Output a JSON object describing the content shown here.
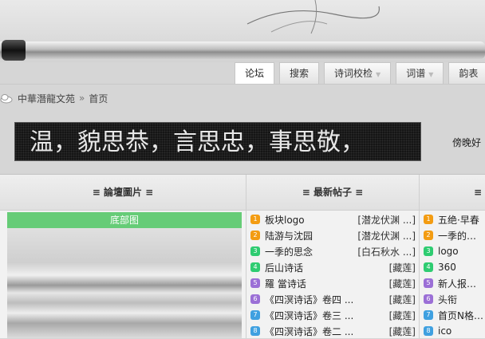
{
  "nav": {
    "tabs": [
      {
        "label": "论坛",
        "active": true,
        "arrow": false
      },
      {
        "label": "搜索",
        "active": false,
        "arrow": false
      },
      {
        "label": "诗词校检",
        "active": false,
        "arrow": true
      },
      {
        "label": "词谱",
        "active": false,
        "arrow": true
      },
      {
        "label": "韵表",
        "active": false,
        "arrow": false
      }
    ]
  },
  "breadcrumb": {
    "site": "中華潛龍文苑",
    "separator": "»",
    "page": "首页"
  },
  "banner": {
    "text": "温，貌思恭，言思忠，事思敬，"
  },
  "user": {
    "greeting": "傍晚好"
  },
  "panels": {
    "pictures": {
      "title": "≡ 論壇圖片 ≡",
      "caption": "底部图"
    },
    "latest": {
      "title": "≡ 最新帖子 ≡",
      "items": [
        {
          "n": "1",
          "color": "#f39c12",
          "title": "板块logo",
          "author": "[潜龙伏渊 ...]"
        },
        {
          "n": "2",
          "color": "#f39c12",
          "title": "陆游与沈园",
          "author": "[潜龙伏渊 ...]"
        },
        {
          "n": "3",
          "color": "#2ecc71",
          "title": "一季的思念",
          "author": "[白石秋水 ...]"
        },
        {
          "n": "4",
          "color": "#2ecc71",
          "title": "后山诗话",
          "author": "[藏莲]"
        },
        {
          "n": "5",
          "color": "#9b6fd6",
          "title": "羅 當诗话",
          "author": "[藏莲]"
        },
        {
          "n": "6",
          "color": "#9b6fd6",
          "title": "《四溟诗话》卷四 ...",
          "author": "[藏莲]"
        },
        {
          "n": "7",
          "color": "#3fa0e0",
          "title": "《四溟诗话》卷三 ...",
          "author": "[藏莲]"
        },
        {
          "n": "8",
          "color": "#3fa0e0",
          "title": "《四溟诗话》卷二 ...",
          "author": "[藏莲]"
        }
      ]
    },
    "third": {
      "title": "≡",
      "items": [
        {
          "n": "1",
          "color": "#f39c12",
          "title": "五绝·早春"
        },
        {
          "n": "2",
          "color": "#f39c12",
          "title": "一季的思念"
        },
        {
          "n": "3",
          "color": "#2ecc71",
          "title": "logo"
        },
        {
          "n": "4",
          "color": "#2ecc71",
          "title": "360"
        },
        {
          "n": "5",
          "color": "#9b6fd6",
          "title": "新人报道测"
        },
        {
          "n": "6",
          "color": "#9b6fd6",
          "title": "头衔"
        },
        {
          "n": "7",
          "color": "#3fa0e0",
          "title": "首页N格(仿"
        },
        {
          "n": "8",
          "color": "#3fa0e0",
          "title": "ico"
        }
      ]
    }
  }
}
